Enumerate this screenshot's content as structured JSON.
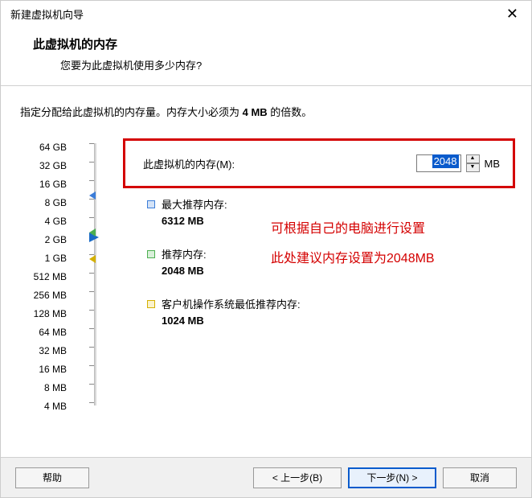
{
  "window": {
    "title": "新建虚拟机向导",
    "close": "✕"
  },
  "header": {
    "title": "此虚拟机的内存",
    "subtitle": "您要为此虚拟机使用多少内存?"
  },
  "instruction": {
    "prefix": "指定分配给此虚拟机的内存量。内存大小必须为 ",
    "bold": "4 MB",
    "suffix": " 的倍数。"
  },
  "memory": {
    "label": "此虚拟机的内存(M):",
    "value": "2048",
    "unit": "MB"
  },
  "scale": [
    "64 GB",
    "32 GB",
    "16 GB",
    "8 GB",
    "4 GB",
    "2 GB",
    "1 GB",
    "512 MB",
    "256 MB",
    "128 MB",
    "64 MB",
    "32 MB",
    "16 MB",
    "8 MB",
    "4 MB"
  ],
  "recommendations": {
    "max": {
      "label": "最大推荐内存:",
      "value": "6312 MB"
    },
    "rec": {
      "label": "推荐内存:",
      "value": "2048 MB"
    },
    "min": {
      "label": "客户机操作系统最低推荐内存:",
      "value": "1024 MB"
    }
  },
  "annotations": {
    "line1": "可根据自己的电脑进行设置",
    "line2": "此处建议内存设置为2048MB"
  },
  "buttons": {
    "help": "帮助",
    "back": "< 上一步(B)",
    "next": "下一步(N) >",
    "cancel": "取消"
  }
}
